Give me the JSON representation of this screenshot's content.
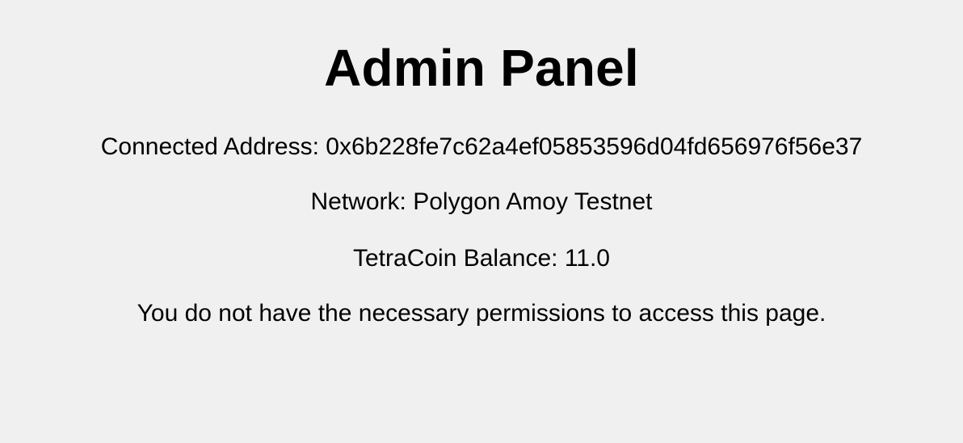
{
  "page": {
    "title": "Admin Panel"
  },
  "account": {
    "address_label": "Connected Address: ",
    "address": "0x6b228fe7c62a4ef05853596d04fd656976f56e37",
    "network_label": "Network: ",
    "network": "Polygon Amoy Testnet",
    "balance_label": "TetraCoin Balance: ",
    "balance": "11.0"
  },
  "message": {
    "permission_denied": "You do not have the necessary permissions to access this page."
  },
  "colors": {
    "background": "#f0f0f0",
    "text": "#000000"
  }
}
